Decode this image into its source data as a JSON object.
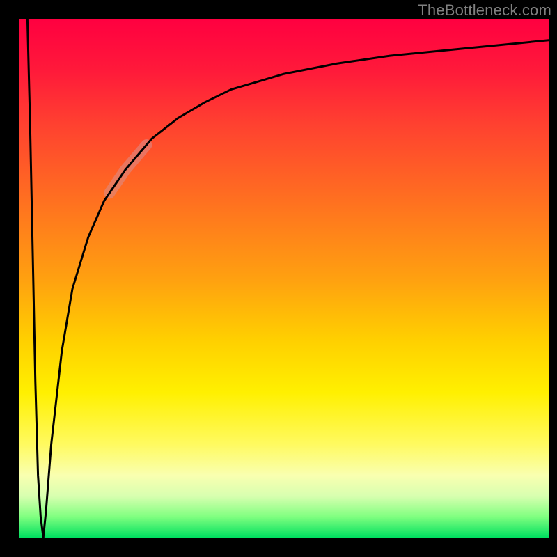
{
  "watermark": "TheBottleneck.com",
  "chart_data": {
    "type": "line",
    "title": "",
    "xlabel": "",
    "ylabel": "",
    "xlim": [
      0,
      100
    ],
    "ylim": [
      0,
      100
    ],
    "background_gradient": {
      "stops": [
        {
          "pos": 0,
          "color": "#ff0040"
        },
        {
          "pos": 50,
          "color": "#ffa010"
        },
        {
          "pos": 72,
          "color": "#fff000"
        },
        {
          "pos": 100,
          "color": "#00e060"
        }
      ]
    },
    "series": [
      {
        "name": "curve-down",
        "color": "#000000",
        "x": [
          1.5,
          2.0,
          2.5,
          3.0,
          3.5,
          4.0,
          4.5
        ],
        "y": [
          100,
          80,
          55,
          30,
          12,
          4,
          0
        ]
      },
      {
        "name": "curve-up",
        "color": "#000000",
        "x": [
          4.5,
          5,
          6,
          8,
          10,
          13,
          16,
          20,
          25,
          30,
          35,
          40,
          50,
          60,
          70,
          80,
          90,
          100
        ],
        "y": [
          0,
          5,
          18,
          36,
          48,
          58,
          65,
          71,
          77,
          81,
          84,
          86.5,
          89.5,
          91.5,
          93,
          94,
          95,
          96
        ]
      }
    ],
    "highlight_segment": {
      "on_series": "curve-up",
      "x_range": [
        17,
        24
      ],
      "color": "#d98e8e",
      "opacity": 0.55,
      "width": 16
    }
  }
}
